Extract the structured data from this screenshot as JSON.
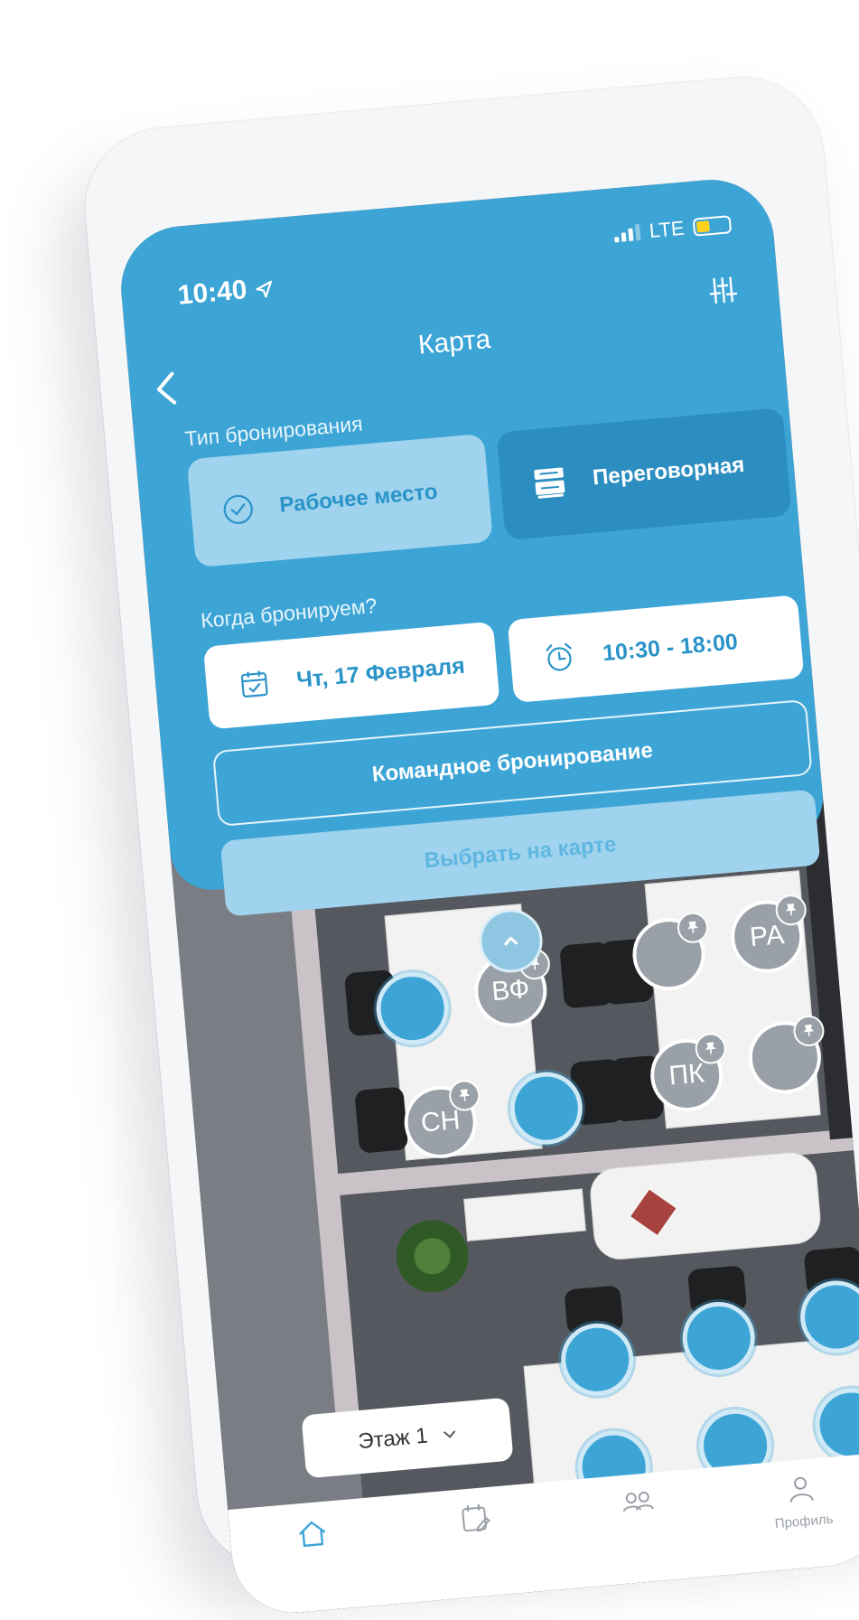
{
  "status": {
    "time": "10:40",
    "network": "LTE"
  },
  "header": {
    "title": "Карта"
  },
  "booking_type": {
    "label": "Тип бронирования",
    "options": [
      {
        "label": "Рабочее место",
        "selected": true
      },
      {
        "label": "Переговорная",
        "selected": false
      }
    ]
  },
  "when": {
    "label": "Когда бронируем?",
    "date": "Чт, 17 Февраля",
    "time": "10:30 - 18:00"
  },
  "team_booking_label": "Командное бронирование",
  "choose_on_map_label": "Выбрать на карте",
  "seats": {
    "occupied": [
      "ВФ",
      "РА",
      "СН",
      "ПК"
    ]
  },
  "floor": {
    "label": "Этаж 1"
  },
  "tabbar": {
    "profile_label": "Профиль"
  },
  "colors": {
    "accent": "#3da5d6",
    "panel_dark": "#2c8ec0",
    "light": "#9fd3ee"
  }
}
